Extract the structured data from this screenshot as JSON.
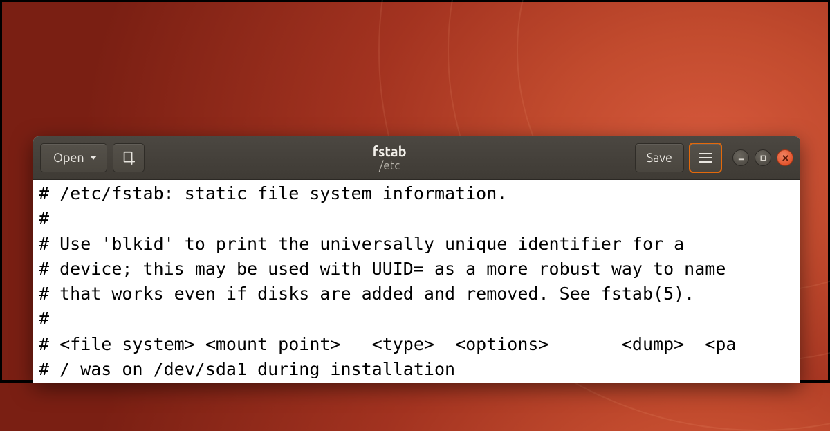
{
  "header": {
    "open_label": "Open",
    "save_label": "Save",
    "title": "fstab",
    "subtitle": "/etc"
  },
  "editor": {
    "content": "# /etc/fstab: static file system information.\n#\n# Use 'blkid' to print the universally unique identifier for a\n# device; this may be used with UUID= as a more robust way to name\n# that works even if disks are added and removed. See fstab(5).\n#\n# <file system> <mount point>   <type>  <options>       <dump>  <pa\n# / was on /dev/sda1 during installation"
  }
}
